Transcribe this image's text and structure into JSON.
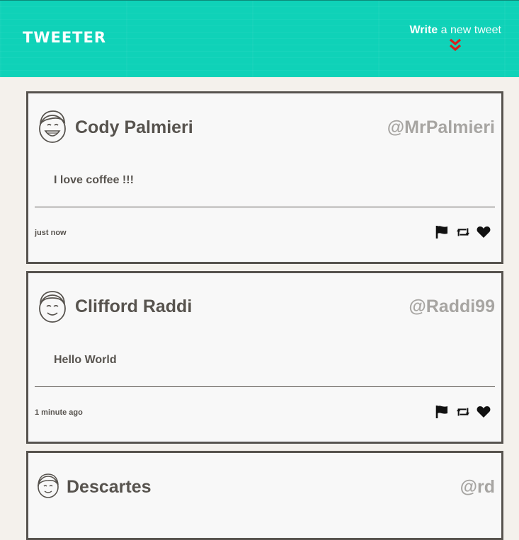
{
  "header": {
    "logo": "Tweeter",
    "compose_strong": "Write",
    "compose_rest": " a new tweet",
    "accent_color": "#0fd2b8",
    "chevron_color": "#d9201c"
  },
  "tweets": [
    {
      "name": "Cody Palmieri",
      "handle": "@MrPalmieri",
      "text": "I love coffee !!!",
      "time": "just now",
      "avatar_icon": "smiling-man-avatar-icon"
    },
    {
      "name": "Clifford Raddi",
      "handle": "@Raddi99",
      "text": "Hello World",
      "time": "1 minute ago",
      "avatar_icon": "man-avatar-icon"
    },
    {
      "name": "Descartes",
      "handle": "@rd",
      "text": "",
      "time": "",
      "avatar_icon": "woman-avatar-icon"
    }
  ],
  "action_icons": [
    "flag-icon",
    "retweet-icon",
    "heart-icon"
  ]
}
